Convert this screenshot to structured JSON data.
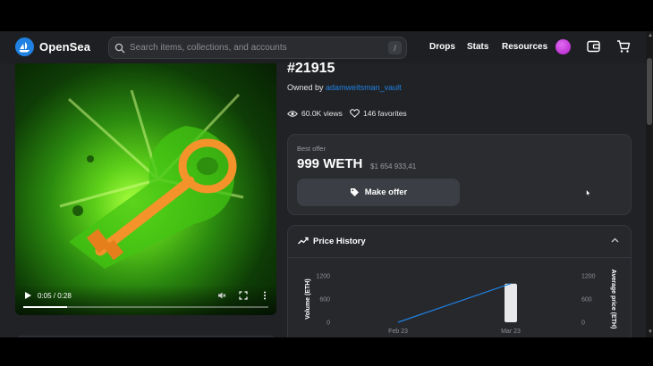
{
  "nav": {
    "brand": "OpenSea",
    "search_placeholder": "Search items, collections, and accounts",
    "search_shortcut": "/",
    "links": [
      "Drops",
      "Stats",
      "Resources"
    ]
  },
  "media": {
    "time": "0:05 / 0:28",
    "progress": 0.18
  },
  "item": {
    "title": "#21915",
    "owned_by_prefix": "Owned by",
    "owner": "adamweitsman_vault",
    "views": "60.0K views",
    "favorites": "146 favorites"
  },
  "offer": {
    "label": "Best offer",
    "price": "999 WETH",
    "usd": "$1 654 933,41",
    "button": "Make offer"
  },
  "price_history": {
    "title": "Price History"
  },
  "chart_data": {
    "type": "bar",
    "categories": [
      "Feb 23",
      "Mar 23"
    ],
    "y_left_label": "Volume (ETH)",
    "y_right_label": "Average price (ETH)",
    "y_ticks": [
      "0",
      "600",
      "1200"
    ],
    "ylim": [
      0,
      1200
    ],
    "series": [
      {
        "kind": "bar",
        "values": [
          0,
          999
        ]
      },
      {
        "kind": "line",
        "values": [
          0,
          999
        ]
      }
    ],
    "colors": {
      "bar": "#e8e8ea",
      "line": "#2081e2"
    }
  }
}
